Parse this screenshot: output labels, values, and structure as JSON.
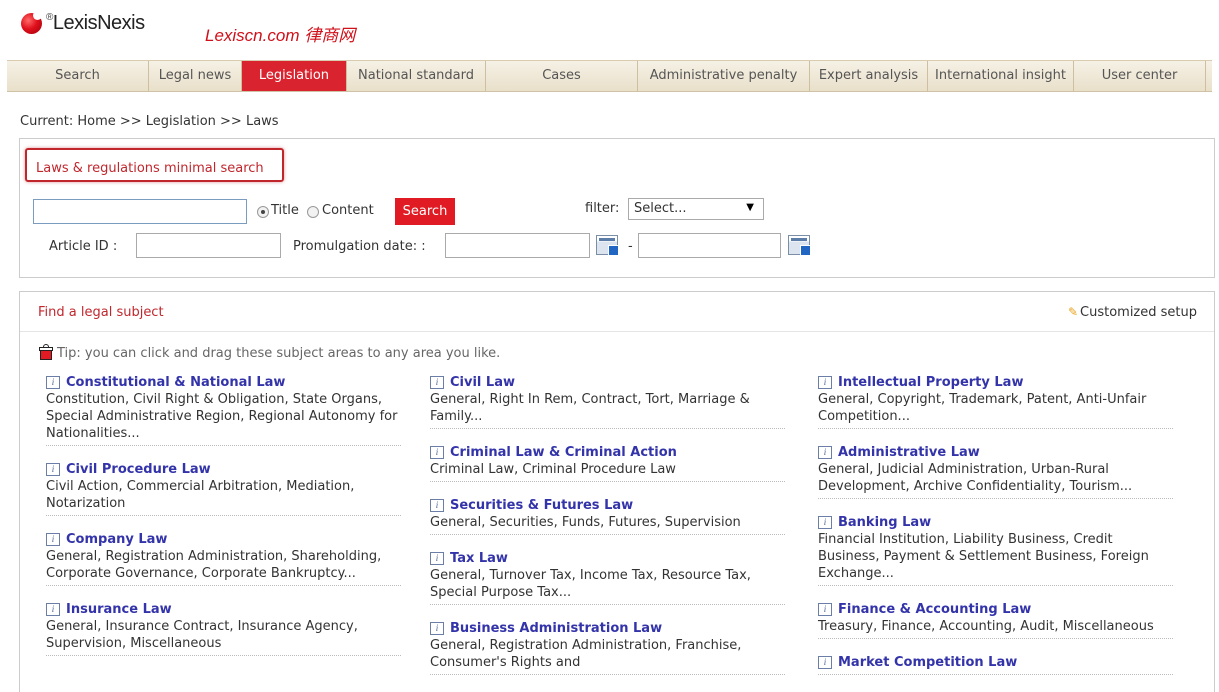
{
  "header": {
    "logo_text": "LexisNexis",
    "logo_mark": "®",
    "site_name": "Lexiscn.com 律商网"
  },
  "nav": {
    "items": [
      {
        "label": "Search",
        "width": 142,
        "active": false
      },
      {
        "label": "Legal news",
        "width": 93,
        "active": false
      },
      {
        "label": "Legislation",
        "width": 105,
        "active": true
      },
      {
        "label": "National standard",
        "width": 139,
        "active": false
      },
      {
        "label": "Cases",
        "width": 152,
        "active": false
      },
      {
        "label": "Administrative penalty",
        "width": 172,
        "active": false
      },
      {
        "label": "Expert analysis",
        "width": 118,
        "active": false
      },
      {
        "label": "International insight",
        "width": 146,
        "active": false
      },
      {
        "label": "User center",
        "width": 132,
        "active": false
      }
    ]
  },
  "breadcrumb": "Current: Home >> Legislation >> Laws",
  "search": {
    "title": "Laws & regulations minimal search",
    "query_value": "",
    "radio_title": "Title",
    "radio_content": "Content",
    "button": "Search",
    "filter_label": "filter:",
    "filter_selected": "Select...",
    "article_id_label": "Article ID :",
    "promulgation_label": "Promulgation date: :",
    "dash": "-"
  },
  "subjects": {
    "title": "Find a legal subject",
    "customized": "Customized setup",
    "tip": "Tip: you can click and drag these subject areas to any area you like.",
    "columns": [
      [
        {
          "name": "Constitutional & National Law",
          "desc": "Constitution, Civil Right & Obligation, State Organs, Special Administrative Region, Regional Autonomy for Nationalities..."
        },
        {
          "name": "Civil Procedure Law",
          "desc": "Civil Action, Commercial Arbitration, Mediation, Notarization"
        },
        {
          "name": "Company Law",
          "desc": "General, Registration Administration, Shareholding, Corporate Governance, Corporate Bankruptcy..."
        },
        {
          "name": "Insurance Law",
          "desc": "General, Insurance Contract, Insurance Agency, Supervision, Miscellaneous"
        }
      ],
      [
        {
          "name": "Civil Law",
          "desc": "General, Right In Rem, Contract, Tort, Marriage & Family..."
        },
        {
          "name": "Criminal Law & Criminal Action",
          "desc": "Criminal Law, Criminal Procedure Law"
        },
        {
          "name": "Securities & Futures Law",
          "desc": "General, Securities, Funds, Futures, Supervision"
        },
        {
          "name": "Tax Law",
          "desc": "General, Turnover Tax, Income Tax, Resource Tax, Special Purpose Tax..."
        },
        {
          "name": "Business Administration Law",
          "desc": "General, Registration Administration, Franchise, Consumer's Rights and"
        }
      ],
      [
        {
          "name": "Intellectual Property Law",
          "desc": "General, Copyright, Trademark, Patent, Anti-Unfair Competition..."
        },
        {
          "name": "Administrative Law",
          "desc": "General, Judicial Administration, Urban-Rural Development, Archive Confidentiality, Tourism..."
        },
        {
          "name": "Banking Law",
          "desc": "Financial Institution, Liability Business, Credit Business, Payment & Settlement Business, Foreign Exchange..."
        },
        {
          "name": "Finance & Accounting Law",
          "desc": "Treasury, Finance, Accounting, Audit, Miscellaneous"
        },
        {
          "name": "Market Competition Law",
          "desc": ""
        }
      ]
    ]
  }
}
